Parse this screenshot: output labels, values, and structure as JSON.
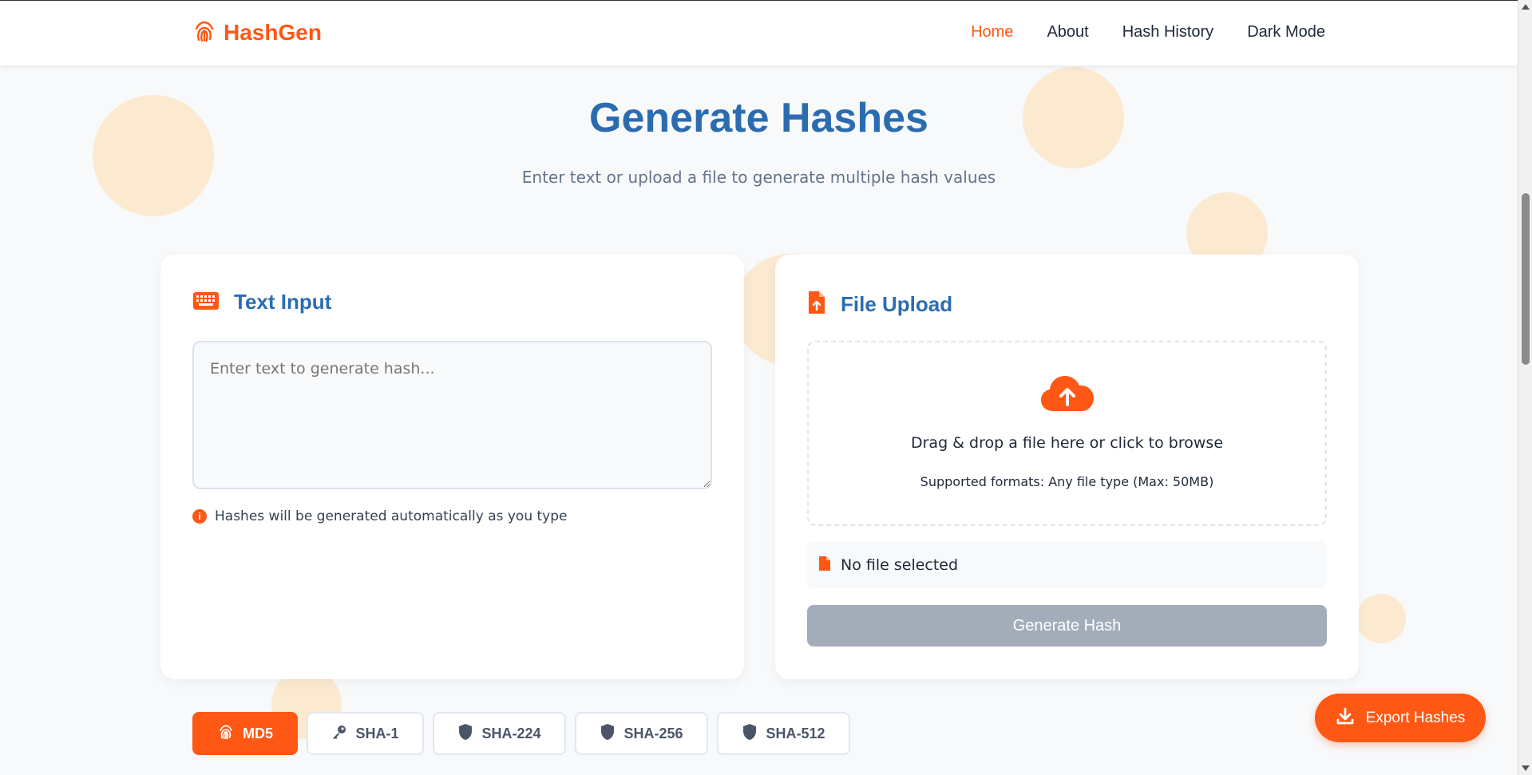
{
  "brand": {
    "name": "HashGen",
    "icon": "fingerprint-icon"
  },
  "nav": {
    "items": [
      {
        "label": "Home",
        "active": true
      },
      {
        "label": "About",
        "active": false
      },
      {
        "label": "Hash History",
        "active": false
      },
      {
        "label": "Dark Mode",
        "active": false
      }
    ]
  },
  "hero": {
    "title": "Generate Hashes",
    "subtitle": "Enter text or upload a file to generate multiple hash values"
  },
  "text_card": {
    "title": "Text Input",
    "icon": "keyboard-icon",
    "placeholder": "Enter text to generate hash...",
    "value": "",
    "hint": "Hashes will be generated automatically as you type",
    "hint_icon": "info-icon"
  },
  "file_card": {
    "title": "File Upload",
    "icon": "file-upload-icon",
    "drop_icon": "cloud-upload-icon",
    "drop_main": "Drag & drop a file here or click to browse",
    "drop_sub": "Supported formats: Any file type (Max: 50MB)",
    "file_status": "No file selected",
    "file_icon": "file-icon",
    "generate_label": "Generate Hash"
  },
  "tabs": [
    {
      "label": "MD5",
      "icon": "fingerprint-icon",
      "active": true
    },
    {
      "label": "SHA-1",
      "icon": "key-icon",
      "active": false
    },
    {
      "label": "SHA-224",
      "icon": "shield-icon",
      "active": false
    },
    {
      "label": "SHA-256",
      "icon": "shield-icon",
      "active": false
    },
    {
      "label": "SHA-512",
      "icon": "shield-icon",
      "active": false
    }
  ],
  "export": {
    "label": "Export Hashes",
    "icon": "download-icon"
  },
  "colors": {
    "accent": "#ff5714",
    "heading": "#2b6cb0",
    "disabled": "#a3adb9",
    "background": "#f7f9fb"
  }
}
